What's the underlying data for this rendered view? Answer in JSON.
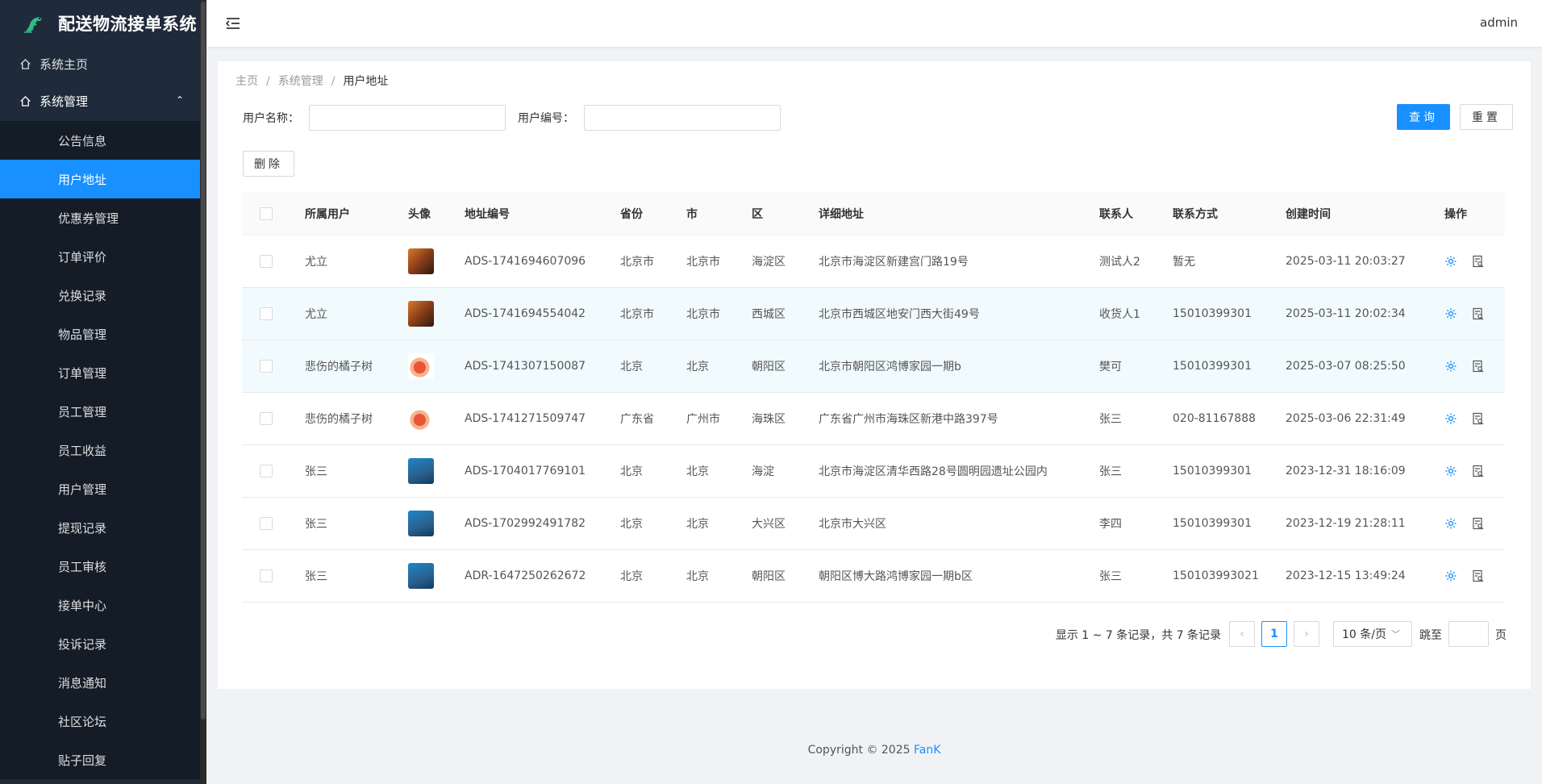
{
  "app": {
    "title": "配送物流接单系统",
    "user": "admin"
  },
  "sidebar": {
    "home": "系统主页",
    "group": "系统管理",
    "items": [
      "公告信息",
      "用户地址",
      "优惠券管理",
      "订单评价",
      "兑换记录",
      "物品管理",
      "订单管理",
      "员工管理",
      "员工收益",
      "用户管理",
      "提现记录",
      "员工审核",
      "接单中心",
      "投诉记录",
      "消息通知",
      "社区论坛",
      "贴子回复"
    ],
    "active_index": 1
  },
  "breadcrumb": [
    "主页",
    "系统管理",
    "用户地址"
  ],
  "search": {
    "name_label": "用户名称：",
    "code_label": "用户编号：",
    "name_value": "",
    "code_value": "",
    "query_btn": "查询",
    "reset_btn": "重置"
  },
  "toolbar": {
    "delete_btn": "删除"
  },
  "table": {
    "headers": [
      "所属用户",
      "头像",
      "地址编号",
      "省份",
      "市",
      "区",
      "详细地址",
      "联系人",
      "联系方式",
      "创建时间",
      "操作"
    ],
    "rows": [
      {
        "user": "尤立",
        "avatar": "a",
        "code": "ADS-1741694607096",
        "province": "北京市",
        "city": "北京市",
        "district": "海淀区",
        "address": "北京市海淀区新建宫门路19号",
        "contact": "测试人2",
        "phone": "暂无",
        "created": "2025-03-11 20:03:27"
      },
      {
        "user": "尤立",
        "avatar": "a",
        "code": "ADS-1741694554042",
        "province": "北京市",
        "city": "北京市",
        "district": "西城区",
        "address": "北京市西城区地安门西大街49号",
        "contact": "收货人1",
        "phone": "15010399301",
        "created": "2025-03-11 20:02:34"
      },
      {
        "user": "悲伤的橘子树",
        "avatar": "b",
        "code": "ADS-1741307150087",
        "province": "北京",
        "city": "北京",
        "district": "朝阳区",
        "address": "北京市朝阳区鸿博家园一期b",
        "contact": "樊可",
        "phone": "15010399301",
        "created": "2025-03-07 08:25:50"
      },
      {
        "user": "悲伤的橘子树",
        "avatar": "b",
        "code": "ADS-1741271509747",
        "province": "广东省",
        "city": "广州市",
        "district": "海珠区",
        "address": "广东省广州市海珠区新港中路397号",
        "contact": "张三",
        "phone": "020-81167888",
        "created": "2025-03-06 22:31:49"
      },
      {
        "user": "张三",
        "avatar": "c",
        "code": "ADS-1704017769101",
        "province": "北京",
        "city": "北京",
        "district": "海淀",
        "address": "北京市海淀区清华西路28号圆明园遗址公园内",
        "contact": "张三",
        "phone": "15010399301",
        "created": "2023-12-31 18:16:09"
      },
      {
        "user": "张三",
        "avatar": "c",
        "code": "ADS-1702992491782",
        "province": "北京",
        "city": "北京",
        "district": "大兴区",
        "address": "北京市大兴区",
        "contact": "李四",
        "phone": "15010399301",
        "created": "2023-12-19 21:28:11"
      },
      {
        "user": "张三",
        "avatar": "c",
        "code": "ADR-1647250262672",
        "province": "北京",
        "city": "北京",
        "district": "朝阳区",
        "address": "朝阳区博大路鸿博家园一期b区",
        "contact": "张三",
        "phone": "150103993021",
        "created": "2023-12-15 13:49:24"
      }
    ]
  },
  "pagination": {
    "info": "显示 1 ~ 7 条记录，共 7 条记录",
    "current": "1",
    "page_size": "10 条/页",
    "jump_label": "跳至",
    "page_unit": "页",
    "prev": "‹",
    "next": "›"
  },
  "footer": {
    "copyright": "Copyright © 2025",
    "brand": "FanK"
  },
  "colors": {
    "primary": "#1890ff",
    "sidebar": "#1f2a3a",
    "submenu": "#141c27"
  }
}
